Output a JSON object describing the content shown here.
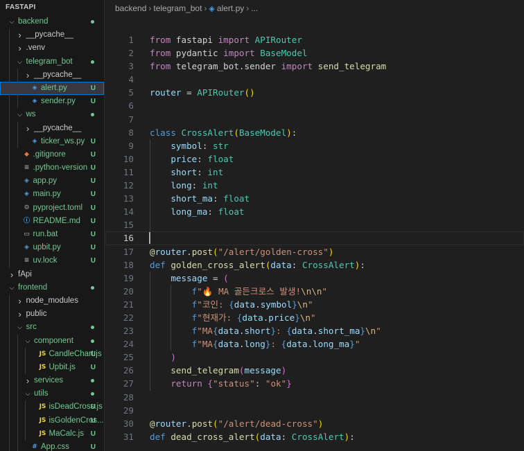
{
  "explorer": {
    "title": "FASTAPI",
    "items": [
      {
        "label": "backend",
        "depth": 0,
        "kind": "folder",
        "open": true,
        "dot": "#73c991"
      },
      {
        "label": "__pycache__",
        "depth": 1,
        "kind": "folder",
        "open": false
      },
      {
        "label": ".venv",
        "depth": 1,
        "kind": "folder",
        "open": false
      },
      {
        "label": "telegram_bot",
        "depth": 1,
        "kind": "folder",
        "open": true,
        "dot": "#73c991"
      },
      {
        "label": "__pycache__",
        "depth": 2,
        "kind": "folder",
        "open": false
      },
      {
        "label": "alert.py",
        "depth": 2,
        "kind": "file",
        "icon": "python-icon",
        "badge": "U",
        "selected": true
      },
      {
        "label": "sender.py",
        "depth": 2,
        "kind": "file",
        "icon": "python-icon",
        "badge": "U"
      },
      {
        "label": "ws",
        "depth": 1,
        "kind": "folder",
        "open": true,
        "dot": "#73c991"
      },
      {
        "label": "__pycache__",
        "depth": 2,
        "kind": "folder",
        "open": false
      },
      {
        "label": "ticker_ws.py",
        "depth": 2,
        "kind": "file",
        "icon": "python-icon",
        "badge": "U"
      },
      {
        "label": ".gitignore",
        "depth": 1,
        "kind": "file",
        "icon": "git-icon",
        "badge": "U"
      },
      {
        "label": ".python-version",
        "depth": 1,
        "kind": "file",
        "icon": "text-file-icon",
        "badge": "U"
      },
      {
        "label": "app.py",
        "depth": 1,
        "kind": "file",
        "icon": "python-icon",
        "badge": "U"
      },
      {
        "label": "main.py",
        "depth": 1,
        "kind": "file",
        "icon": "python-icon",
        "badge": "U"
      },
      {
        "label": "pyproject.toml",
        "depth": 1,
        "kind": "file",
        "icon": "gear-icon",
        "badge": "U"
      },
      {
        "label": "README.md",
        "depth": 1,
        "kind": "file",
        "icon": "info-icon",
        "badge": "U"
      },
      {
        "label": "run.bat",
        "depth": 1,
        "kind": "file",
        "icon": "bat-icon",
        "badge": "U"
      },
      {
        "label": "upbit.py",
        "depth": 1,
        "kind": "file",
        "icon": "python-icon",
        "badge": "U"
      },
      {
        "label": "uv.lock",
        "depth": 1,
        "kind": "file",
        "icon": "text-file-icon",
        "badge": "U"
      },
      {
        "label": "fApi",
        "depth": 0,
        "kind": "folder",
        "open": false
      },
      {
        "label": "frontend",
        "depth": 0,
        "kind": "folder",
        "open": true,
        "dot": "#73c991"
      },
      {
        "label": "node_modules",
        "depth": 1,
        "kind": "folder",
        "open": false
      },
      {
        "label": "public",
        "depth": 1,
        "kind": "folder",
        "open": false
      },
      {
        "label": "src",
        "depth": 1,
        "kind": "folder",
        "open": true,
        "dot": "#73c991"
      },
      {
        "label": "component",
        "depth": 2,
        "kind": "folder",
        "open": true,
        "dot": "#73c991"
      },
      {
        "label": "CandleChart.js",
        "depth": 3,
        "kind": "file",
        "icon": "js-icon",
        "badge": "U"
      },
      {
        "label": "Upbit.js",
        "depth": 3,
        "kind": "file",
        "icon": "js-icon",
        "badge": "U"
      },
      {
        "label": "services",
        "depth": 2,
        "kind": "folder",
        "open": false,
        "dot": "#73c991"
      },
      {
        "label": "utils",
        "depth": 2,
        "kind": "folder",
        "open": true,
        "dot": "#73c991"
      },
      {
        "label": "isDeadCross.js",
        "depth": 3,
        "kind": "file",
        "icon": "js-icon",
        "badge": "U"
      },
      {
        "label": "isGoldenCros...",
        "depth": 3,
        "kind": "file",
        "icon": "js-icon",
        "badge": "U"
      },
      {
        "label": "MaCalc.js",
        "depth": 3,
        "kind": "file",
        "icon": "js-icon",
        "badge": "U"
      },
      {
        "label": "App.css",
        "depth": 2,
        "kind": "file",
        "icon": "css-icon",
        "badge": "U"
      }
    ]
  },
  "breadcrumb": [
    "backend",
    "telegram_bot",
    "alert.py",
    "..."
  ],
  "editor": {
    "current_line": 16,
    "lines": [
      {
        "n": "1",
        "t": [
          [
            "from",
            "m"
          ],
          [
            " fastapi ",
            "c0"
          ],
          [
            "import",
            "m"
          ],
          [
            " APIRouter",
            "c"
          ]
        ]
      },
      {
        "n": "2",
        "t": [
          [
            "from",
            "m"
          ],
          [
            " pydantic ",
            "c0"
          ],
          [
            "import",
            "m"
          ],
          [
            " BaseModel",
            "c"
          ]
        ]
      },
      {
        "n": "3",
        "t": [
          [
            "from",
            "m"
          ],
          [
            " telegram_bot.sender ",
            "c0"
          ],
          [
            "import",
            "m"
          ],
          [
            " send_telegram",
            "f"
          ]
        ]
      },
      {
        "n": "4",
        "t": []
      },
      {
        "n": "5",
        "t": [
          [
            "router",
            "v"
          ],
          [
            " = ",
            "p"
          ],
          [
            "APIRouter",
            "c"
          ],
          [
            "()",
            "b"
          ]
        ]
      },
      {
        "n": "6",
        "t": []
      },
      {
        "n": "7",
        "t": []
      },
      {
        "n": "8",
        "t": [
          [
            "class",
            "k"
          ],
          [
            " ",
            "p"
          ],
          [
            "CrossAlert",
            "c"
          ],
          [
            "(",
            "b"
          ],
          [
            "BaseModel",
            "c"
          ],
          [
            ")",
            "b"
          ],
          [
            ":",
            "p"
          ]
        ]
      },
      {
        "n": "9",
        "i": 1,
        "t": [
          [
            "    symbol",
            "v"
          ],
          [
            ": ",
            "p"
          ],
          [
            "str",
            "c"
          ]
        ]
      },
      {
        "n": "10",
        "i": 1,
        "t": [
          [
            "    price",
            "v"
          ],
          [
            ": ",
            "p"
          ],
          [
            "float",
            "c"
          ]
        ]
      },
      {
        "n": "11",
        "i": 1,
        "t": [
          [
            "    short",
            "v"
          ],
          [
            ": ",
            "p"
          ],
          [
            "int",
            "c"
          ]
        ]
      },
      {
        "n": "12",
        "i": 1,
        "t": [
          [
            "    long",
            "v"
          ],
          [
            ": ",
            "p"
          ],
          [
            "int",
            "c"
          ]
        ]
      },
      {
        "n": "13",
        "i": 1,
        "t": [
          [
            "    short_ma",
            "v"
          ],
          [
            ": ",
            "p"
          ],
          [
            "float",
            "c"
          ]
        ]
      },
      {
        "n": "14",
        "i": 1,
        "t": [
          [
            "    long_ma",
            "v"
          ],
          [
            ": ",
            "p"
          ],
          [
            "float",
            "c"
          ]
        ]
      },
      {
        "n": "15",
        "i": 1,
        "t": []
      },
      {
        "n": "16",
        "t": []
      },
      {
        "n": "17",
        "t": [
          [
            "@",
            "f"
          ],
          [
            "router",
            "v"
          ],
          [
            ".",
            "p"
          ],
          [
            "post",
            "f"
          ],
          [
            "(",
            "b"
          ],
          [
            "\"/alert/golden-cross\"",
            "s"
          ],
          [
            ")",
            "b"
          ]
        ]
      },
      {
        "n": "18",
        "t": [
          [
            "def",
            "k"
          ],
          [
            " ",
            "p"
          ],
          [
            "golden_cross_alert",
            "f"
          ],
          [
            "(",
            "b"
          ],
          [
            "data",
            "v"
          ],
          [
            ": ",
            "p"
          ],
          [
            "CrossAlert",
            "c"
          ],
          [
            ")",
            "b"
          ],
          [
            ":",
            "p"
          ]
        ]
      },
      {
        "n": "19",
        "i": 1,
        "t": [
          [
            "    message",
            "v"
          ],
          [
            " = ",
            "p"
          ],
          [
            "(",
            "b2"
          ]
        ]
      },
      {
        "n": "20",
        "i": 2,
        "t": [
          [
            "        f",
            "k"
          ],
          [
            "\"🔥 MA 골든크로스 발생!",
            "s"
          ],
          [
            "\\n\\n",
            "e"
          ],
          [
            "\"",
            "s"
          ]
        ]
      },
      {
        "n": "21",
        "i": 2,
        "t": [
          [
            "        f",
            "k"
          ],
          [
            "\"코인: ",
            "s"
          ],
          [
            "{",
            "k"
          ],
          [
            "data",
            "v"
          ],
          [
            ".",
            "p"
          ],
          [
            "symbol",
            "v"
          ],
          [
            "}",
            "k"
          ],
          [
            "\\n",
            "e"
          ],
          [
            "\"",
            "s"
          ]
        ]
      },
      {
        "n": "22",
        "i": 2,
        "t": [
          [
            "        f",
            "k"
          ],
          [
            "\"현재가: ",
            "s"
          ],
          [
            "{",
            "k"
          ],
          [
            "data",
            "v"
          ],
          [
            ".",
            "p"
          ],
          [
            "price",
            "v"
          ],
          [
            "}",
            "k"
          ],
          [
            "\\n",
            "e"
          ],
          [
            "\"",
            "s"
          ]
        ]
      },
      {
        "n": "23",
        "i": 2,
        "t": [
          [
            "        f",
            "k"
          ],
          [
            "\"MA",
            "s"
          ],
          [
            "{",
            "k"
          ],
          [
            "data",
            "v"
          ],
          [
            ".",
            "p"
          ],
          [
            "short",
            "v"
          ],
          [
            "}",
            "k"
          ],
          [
            ": ",
            "s"
          ],
          [
            "{",
            "k"
          ],
          [
            "data",
            "v"
          ],
          [
            ".",
            "p"
          ],
          [
            "short_ma",
            "v"
          ],
          [
            "}",
            "k"
          ],
          [
            "\\n",
            "e"
          ],
          [
            "\"",
            "s"
          ]
        ]
      },
      {
        "n": "24",
        "i": 2,
        "t": [
          [
            "        f",
            "k"
          ],
          [
            "\"MA",
            "s"
          ],
          [
            "{",
            "k"
          ],
          [
            "data",
            "v"
          ],
          [
            ".",
            "p"
          ],
          [
            "long",
            "v"
          ],
          [
            "}",
            "k"
          ],
          [
            ": ",
            "s"
          ],
          [
            "{",
            "k"
          ],
          [
            "data",
            "v"
          ],
          [
            ".",
            "p"
          ],
          [
            "long_ma",
            "v"
          ],
          [
            "}",
            "k"
          ],
          [
            "\"",
            "s"
          ]
        ]
      },
      {
        "n": "25",
        "i": 1,
        "t": [
          [
            "    ",
            "p"
          ],
          [
            ")",
            "b2"
          ]
        ]
      },
      {
        "n": "26",
        "i": 1,
        "t": [
          [
            "    send_telegram",
            "f"
          ],
          [
            "(",
            "b2"
          ],
          [
            "message",
            "v"
          ],
          [
            ")",
            "b2"
          ]
        ]
      },
      {
        "n": "27",
        "i": 1,
        "t": [
          [
            "    return",
            "m"
          ],
          [
            " ",
            "p"
          ],
          [
            "{",
            "b2"
          ],
          [
            "\"status\"",
            "s"
          ],
          [
            ": ",
            "p"
          ],
          [
            "\"ok\"",
            "s"
          ],
          [
            "}",
            "b2"
          ]
        ]
      },
      {
        "n": "28",
        "t": []
      },
      {
        "n": "29",
        "t": []
      },
      {
        "n": "30",
        "t": [
          [
            "@",
            "f"
          ],
          [
            "router",
            "v"
          ],
          [
            ".",
            "p"
          ],
          [
            "post",
            "f"
          ],
          [
            "(",
            "b"
          ],
          [
            "\"/alert/dead-cross\"",
            "s"
          ],
          [
            ")",
            "b"
          ]
        ]
      },
      {
        "n": "31",
        "t": [
          [
            "def",
            "k"
          ],
          [
            " ",
            "p"
          ],
          [
            "dead_cross_alert",
            "f"
          ],
          [
            "(",
            "b"
          ],
          [
            "data",
            "v"
          ],
          [
            ": ",
            "p"
          ],
          [
            "CrossAlert",
            "c"
          ],
          [
            ")",
            "b"
          ],
          [
            ":",
            "p"
          ]
        ]
      }
    ]
  }
}
